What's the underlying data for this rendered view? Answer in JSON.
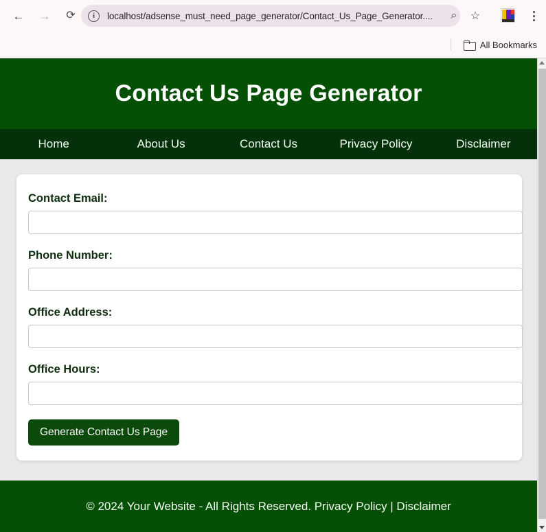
{
  "browser": {
    "back_icon": "arrow-left-icon",
    "forward_icon": "arrow-right-icon",
    "reload_icon": "reload-icon",
    "back_glyph": "←",
    "forward_glyph": "→",
    "reload_glyph": "⟳",
    "site_info_glyph": "ⓘ",
    "url": "localhost/adsense_must_need_page_generator/Contact_Us_Page_Generator....",
    "search_glyph": "⌕",
    "star_glyph": "☆",
    "bookmarks_label": "All Bookmarks"
  },
  "site": {
    "header": {
      "title": "Contact Us Page Generator"
    },
    "nav": {
      "items": [
        {
          "label": "Home"
        },
        {
          "label": "About Us"
        },
        {
          "label": "Contact Us"
        },
        {
          "label": "Privacy Policy"
        },
        {
          "label": "Disclaimer"
        }
      ]
    },
    "form": {
      "fields": [
        {
          "label": "Contact Email:",
          "value": "",
          "placeholder": ""
        },
        {
          "label": "Phone Number:",
          "value": "",
          "placeholder": ""
        },
        {
          "label": "Office Address:",
          "value": "",
          "placeholder": ""
        },
        {
          "label": "Office Hours:",
          "value": "",
          "placeholder": ""
        }
      ],
      "submit_label": "Generate Contact Us Page"
    },
    "footer": {
      "text": "© 2024 Your Website - All Rights Reserved. Privacy Policy | Disclaimer"
    }
  },
  "colors": {
    "header_green": "#065006",
    "nav_green": "#04300a",
    "button_green": "#0b4a0b",
    "page_bg": "#e9e9e9",
    "label_text": "#0d2b0d"
  }
}
